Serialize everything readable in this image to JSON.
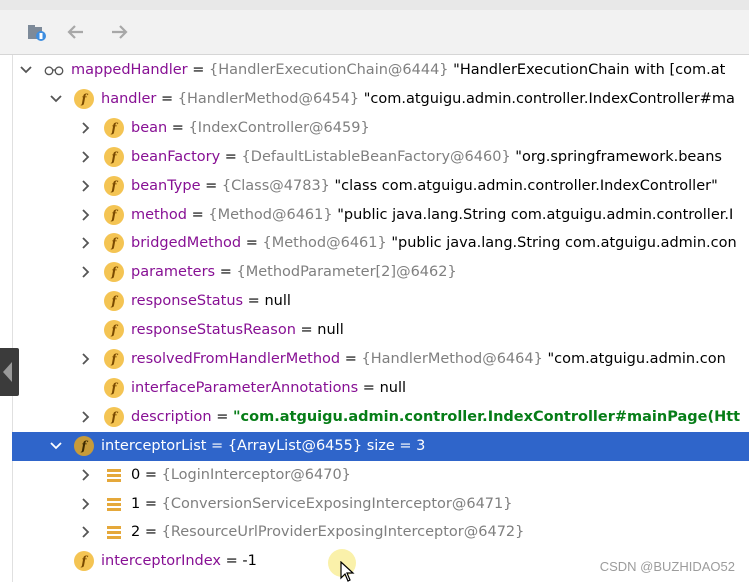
{
  "toolbar": {
    "buttons": [
      {
        "icon": "restore-layout-icon",
        "enabled": true
      },
      {
        "icon": "back-arrow-icon",
        "enabled": false
      },
      {
        "icon": "forward-arrow-icon",
        "enabled": false
      }
    ]
  },
  "tree": [
    {
      "indent": 0,
      "expander": "expanded",
      "icon": "watch",
      "name": "mappedHandler",
      "ref": "{HandlerExecutionChain@6444}",
      "value": "\"HandlerExecutionChain with [com.at",
      "value_style": "str",
      "selected": false
    },
    {
      "indent": 1,
      "expander": "expanded",
      "icon": "field",
      "name": "handler",
      "ref": "{HandlerMethod@6454}",
      "value": "\"com.atguigu.admin.controller.IndexController#ma",
      "value_style": "str",
      "selected": false
    },
    {
      "indent": 2,
      "expander": "collapsed",
      "icon": "field",
      "name": "bean",
      "ref": "{IndexController@6459}",
      "value": "",
      "value_style": "str",
      "selected": false
    },
    {
      "indent": 2,
      "expander": "collapsed",
      "icon": "field",
      "name": "beanFactory",
      "ref": "{DefaultListableBeanFactory@6460}",
      "value": "\"org.springframework.beans",
      "value_style": "str",
      "selected": false
    },
    {
      "indent": 2,
      "expander": "collapsed",
      "icon": "field",
      "name": "beanType",
      "ref": "{Class@4783}",
      "value": "\"class com.atguigu.admin.controller.IndexController\"",
      "value_style": "str",
      "selected": false
    },
    {
      "indent": 2,
      "expander": "collapsed",
      "icon": "field",
      "name": "method",
      "ref": "{Method@6461}",
      "value": "\"public java.lang.String com.atguigu.admin.controller.I",
      "value_style": "str",
      "selected": false
    },
    {
      "indent": 2,
      "expander": "collapsed",
      "icon": "field",
      "name": "bridgedMethod",
      "ref": "{Method@6461}",
      "value": "\"public java.lang.String com.atguigu.admin.con",
      "value_style": "str",
      "selected": false
    },
    {
      "indent": 2,
      "expander": "collapsed",
      "icon": "field",
      "name": "parameters",
      "ref": "{MethodParameter[2]@6462}",
      "value": "",
      "value_style": "str",
      "selected": false
    },
    {
      "indent": 2,
      "expander": "none",
      "icon": "field",
      "name": "responseStatus",
      "ref": "",
      "value": "null",
      "value_style": "val",
      "selected": false
    },
    {
      "indent": 2,
      "expander": "none",
      "icon": "field",
      "name": "responseStatusReason",
      "ref": "",
      "value": "null",
      "value_style": "val",
      "selected": false
    },
    {
      "indent": 2,
      "expander": "collapsed",
      "icon": "field",
      "name": "resolvedFromHandlerMethod",
      "ref": "{HandlerMethod@6464}",
      "value": "\"com.atguigu.admin.con",
      "value_style": "str",
      "selected": false
    },
    {
      "indent": 2,
      "expander": "none",
      "icon": "field",
      "name": "interfaceParameterAnnotations",
      "ref": "",
      "value": "null",
      "value_style": "val",
      "selected": false
    },
    {
      "indent": 2,
      "expander": "collapsed",
      "icon": "field",
      "name": "description",
      "ref": "",
      "value": "\"com.atguigu.admin.controller.IndexController#mainPage(Htt",
      "value_style": "strbold",
      "selected": false
    },
    {
      "indent": 1,
      "expander": "expanded",
      "icon": "field",
      "name": "interceptorList",
      "ref": "{ArrayList@6455}",
      "value": " size = 3",
      "value_style": "val",
      "selected": true
    },
    {
      "indent": 2,
      "expander": "collapsed",
      "icon": "list",
      "name": "0",
      "ref": "{LoginInterceptor@6470}",
      "value": "",
      "value_style": "str",
      "selected": false
    },
    {
      "indent": 2,
      "expander": "collapsed",
      "icon": "list",
      "name": "1",
      "ref": "{ConversionServiceExposingInterceptor@6471}",
      "value": "",
      "value_style": "str",
      "selected": false
    },
    {
      "indent": 2,
      "expander": "collapsed",
      "icon": "list",
      "name": "2",
      "ref": "{ResourceUrlProviderExposingInterceptor@6472}",
      "value": "",
      "value_style": "str",
      "selected": false
    },
    {
      "indent": 1,
      "expander": "none",
      "icon": "field",
      "name": "interceptorIndex",
      "ref": "",
      "value": "-1",
      "value_style": "val",
      "selected": false
    }
  ],
  "watermark": "CSDN @BUZHIDAO52",
  "colors": {
    "selection": "#2f65ca",
    "field_name": "#871094",
    "ref_gray": "#7f7f7f",
    "field_icon": "#f4c453",
    "string_green": "#067d17"
  }
}
